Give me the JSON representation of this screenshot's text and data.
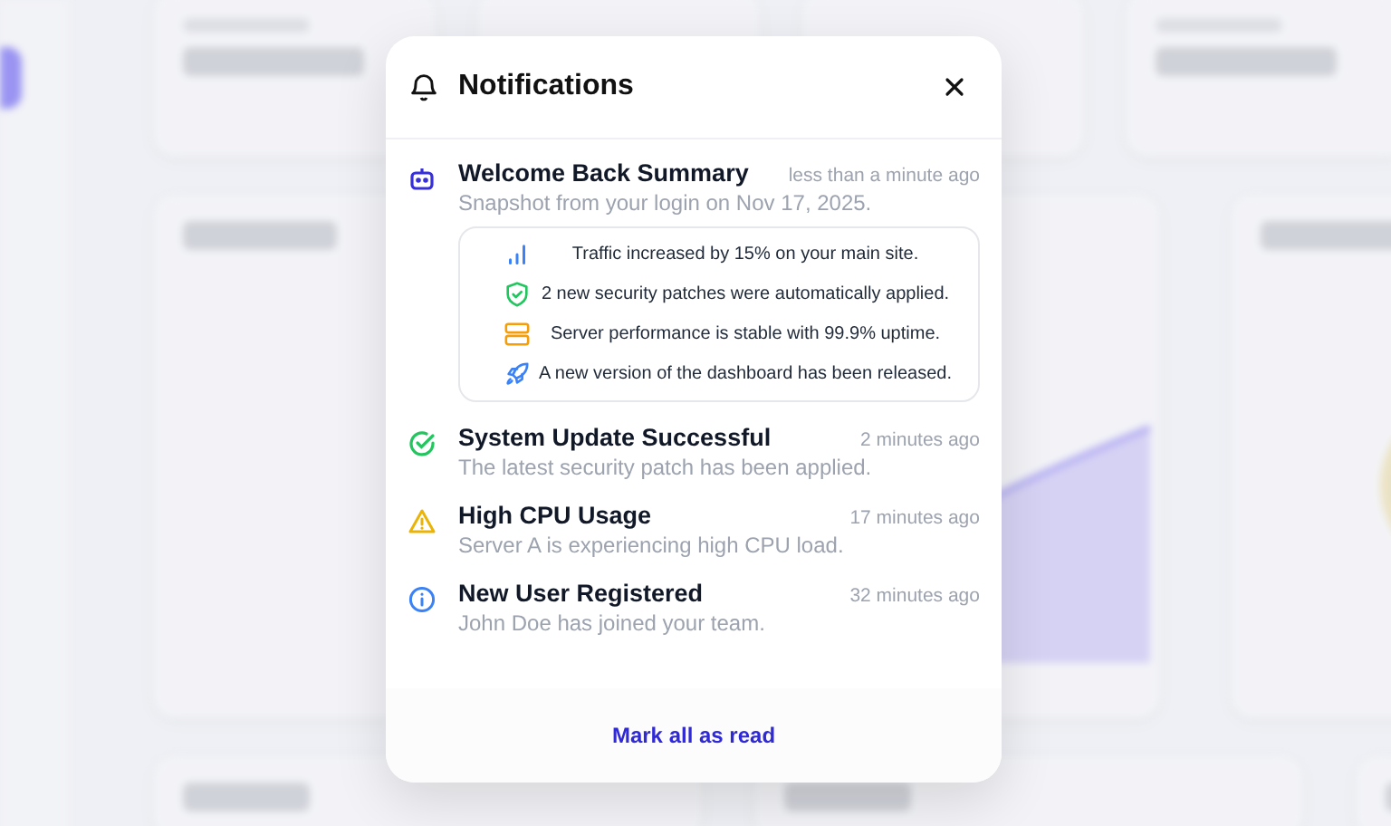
{
  "dialog": {
    "title": "Notifications",
    "notifications": [
      {
        "kind": "summary",
        "title": "Welcome Back Summary",
        "time": "less than a minute ago",
        "text": "Snapshot from your login on Nov 17, 2025.",
        "items": [
          {
            "kind": "chart",
            "text": "Traffic increased by 15% on your main site."
          },
          {
            "kind": "shield",
            "text": "2 new security patches were automatically applied."
          },
          {
            "kind": "server",
            "text": "Server performance is stable with 99.9% uptime."
          },
          {
            "kind": "rocket",
            "text": "A new version of the dashboard has been released."
          }
        ]
      },
      {
        "kind": "success",
        "title": "System Update Successful",
        "time": "2 minutes ago",
        "text": "The latest security patch has been applied."
      },
      {
        "kind": "warning",
        "title": "High CPU Usage",
        "time": "17 minutes ago",
        "text": "Server A is experiencing high CPU load."
      },
      {
        "kind": "info",
        "title": "New User Registered",
        "time": "32 minutes ago",
        "text": "John Doe has joined your team."
      }
    ],
    "footer_link": "Mark all as read"
  }
}
